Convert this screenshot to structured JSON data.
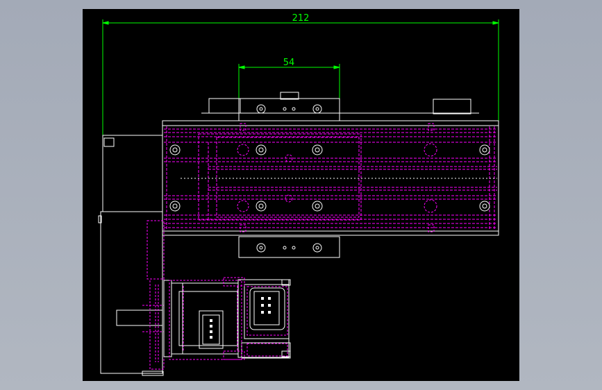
{
  "colors": {
    "background": "#a6adb9",
    "drawing_area": "#000000",
    "outline": "#ffffff",
    "hidden": "#ff00ff",
    "dimension": "#00ff00"
  },
  "dimensions": {
    "overall_width": "212",
    "carriage_width": "54"
  }
}
